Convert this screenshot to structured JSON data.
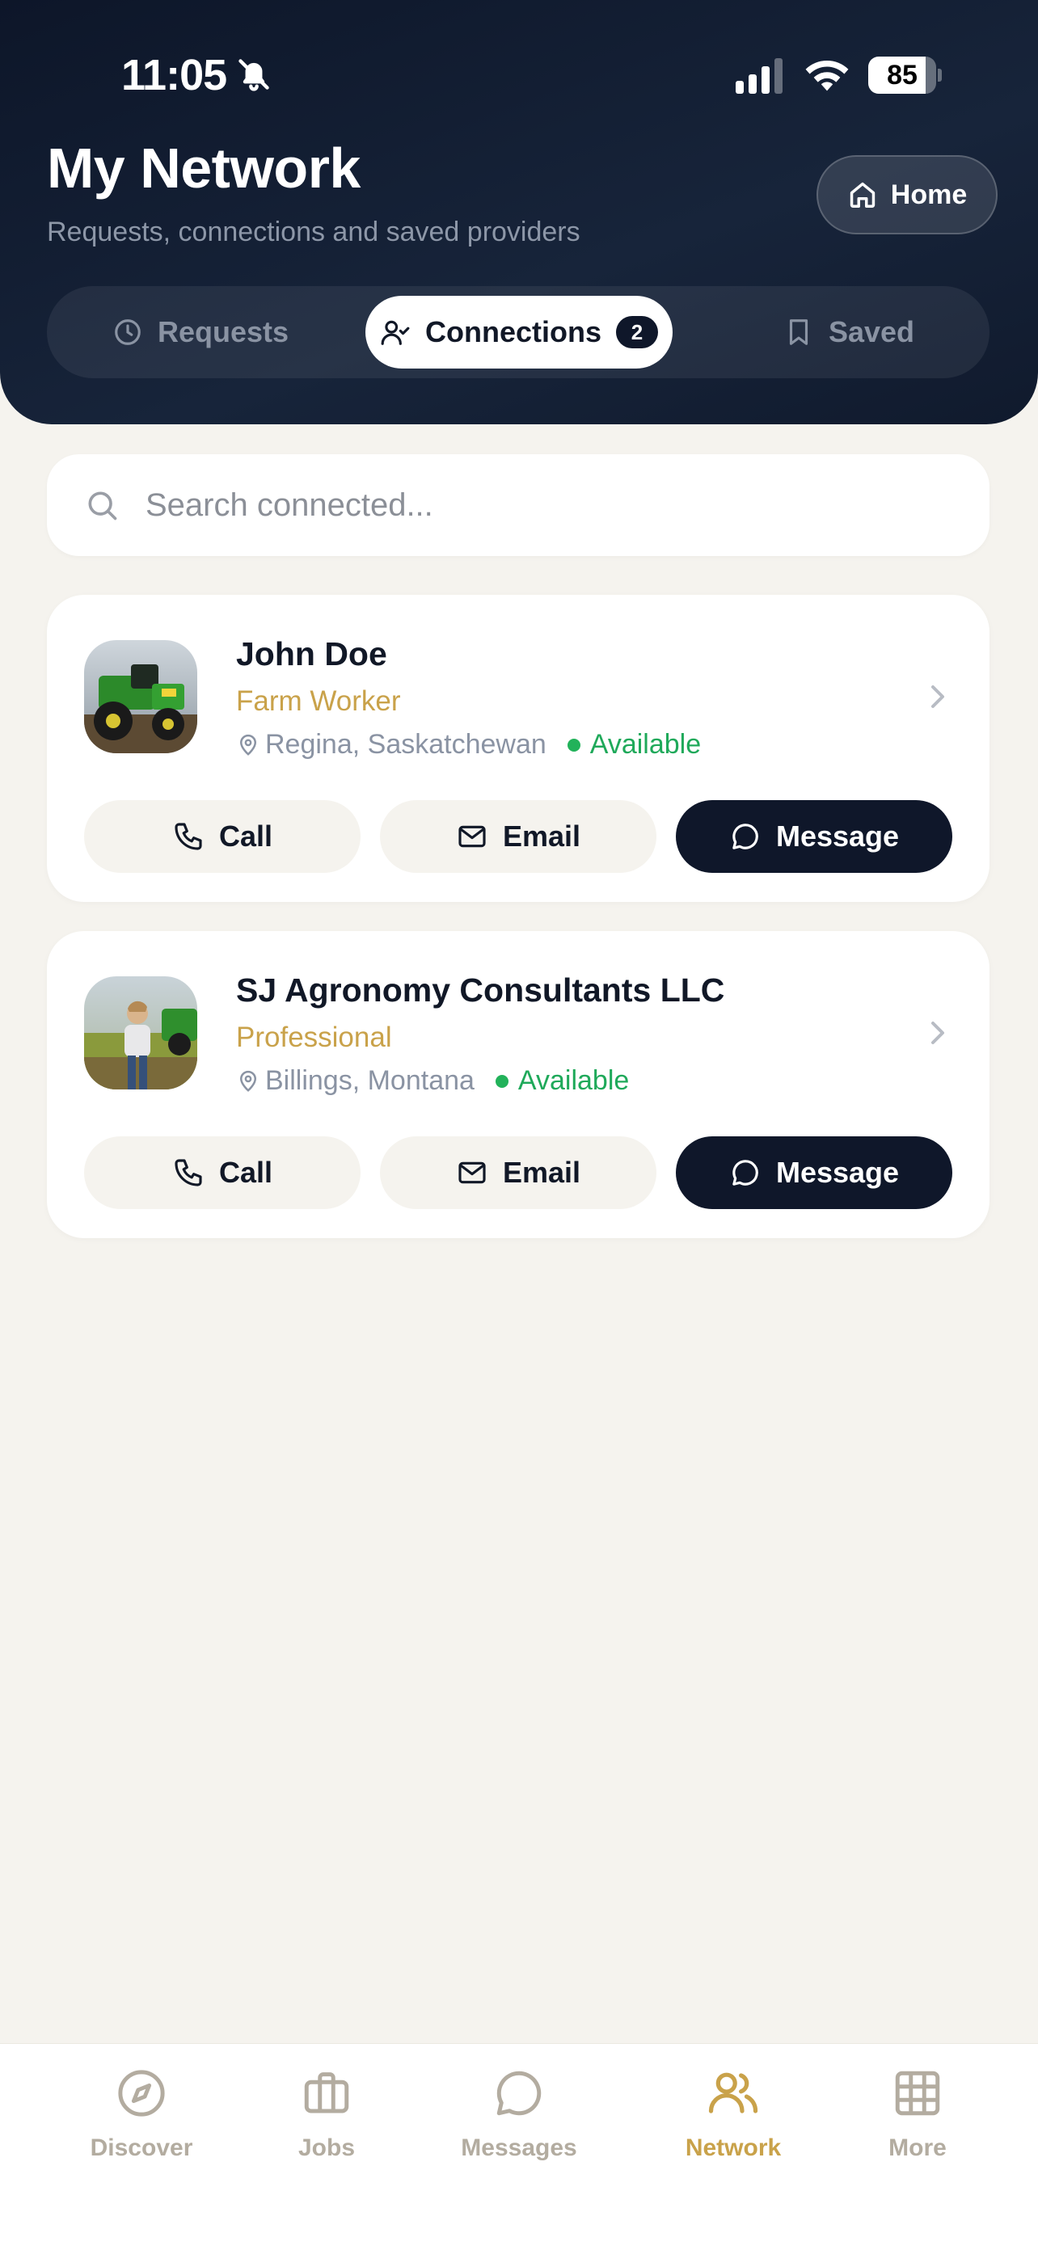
{
  "status_bar": {
    "time": "11:05",
    "battery": "85",
    "battery_level": 0.85
  },
  "header": {
    "title": "My Network",
    "subtitle": "Requests, connections and saved providers",
    "home_label": "Home"
  },
  "tabs": {
    "requests": "Requests",
    "connections": "Connections",
    "connections_count": "2",
    "saved": "Saved",
    "active": "connections"
  },
  "search": {
    "placeholder": "Search connected...",
    "value": ""
  },
  "connections": [
    {
      "name": "John Doe",
      "role": "Farm Worker",
      "location": "Regina, Saskatchewan",
      "status": "Available",
      "avatar": "tractor-photo",
      "actions": {
        "call": "Call",
        "email": "Email",
        "message": "Message"
      }
    },
    {
      "name": "SJ Agronomy Consultants LLC",
      "role": "Professional",
      "location": "Billings, Montana",
      "status": "Available",
      "avatar": "person-field-photo",
      "actions": {
        "call": "Call",
        "email": "Email",
        "message": "Message"
      }
    }
  ],
  "bottom_nav": {
    "items": [
      {
        "label": "Discover",
        "icon": "compass-icon"
      },
      {
        "label": "Jobs",
        "icon": "briefcase-icon"
      },
      {
        "label": "Messages",
        "icon": "chat-bubble-icon"
      },
      {
        "label": "Network",
        "icon": "users-icon"
      },
      {
        "label": "More",
        "icon": "grid-icon"
      }
    ],
    "active": "Network"
  },
  "colors": {
    "header_bg": "#0f172a",
    "accent_gold": "#c9a24a",
    "available_green": "#22b25a",
    "page_bg": "#f5f3ee"
  }
}
